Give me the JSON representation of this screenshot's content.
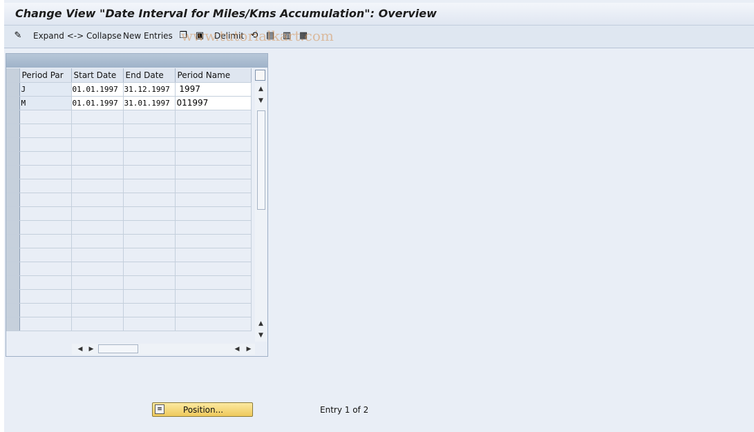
{
  "window": {
    "title": "Change View \"Date Interval for Miles/Kms Accumulation\": Overview",
    "watermark": "www.tutorialkart.com"
  },
  "toolbar": {
    "expand_collapse_label": "Expand <-> Collapse",
    "new_entries_label": "New Entries",
    "delimit_label": "Delimit",
    "icons": [
      "pencil-glasses-icon",
      "copy-icon",
      "save-icon",
      "delete-icon",
      "undo-icon",
      "select-all-icon",
      "select-block-icon",
      "deselect-all-icon"
    ]
  },
  "table": {
    "columns": [
      "Period Par",
      "Start Date",
      "End Date",
      "Period Name"
    ],
    "rows": [
      {
        "period_par": "J",
        "start_date": "01.01.1997",
        "end_date": "31.12.1997",
        "period_name": " 1997"
      },
      {
        "period_par": "M",
        "start_date": "01.01.1997",
        "end_date": "31.01.1997",
        "period_name": "011997"
      }
    ],
    "empty_rows": 16
  },
  "footer": {
    "position_button_label": "Position...",
    "entry_status": "Entry 1 of 2"
  }
}
